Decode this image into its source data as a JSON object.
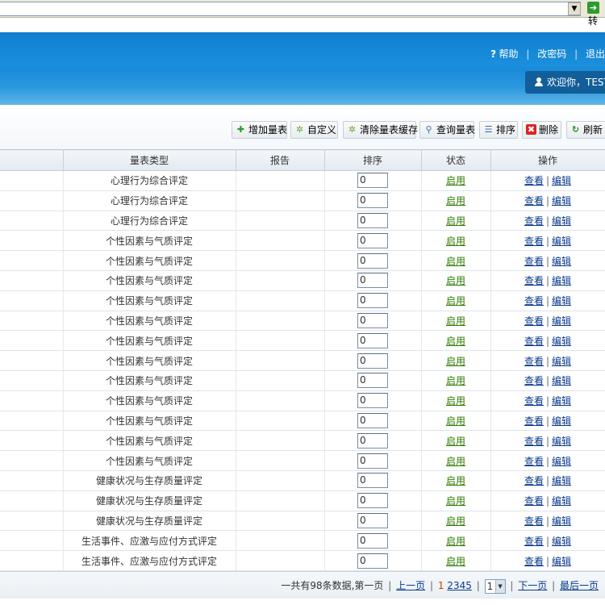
{
  "browser": {
    "go_label": "转"
  },
  "header": {
    "help": "帮助",
    "change_password": "改密码",
    "logout": "退出",
    "welcome": "欢迎你，TEST"
  },
  "toolbar": {
    "add": "增加量表",
    "custom": "自定义",
    "clear_cache": "清除量表缓存",
    "query": "查询量表",
    "sort": "排序",
    "delete": "删除",
    "refresh": "刷新"
  },
  "table": {
    "columns": [
      "",
      "量表类型",
      "报告",
      "排序",
      "状态",
      "操作"
    ],
    "status_label": "启用",
    "view_label": "查看",
    "edit_label": "编辑",
    "rows": [
      {
        "type": "心理行为综合评定",
        "order": "0"
      },
      {
        "type": "心理行为综合评定",
        "order": "0"
      },
      {
        "type": "心理行为综合评定",
        "order": "0"
      },
      {
        "type": "个性因素与气质评定",
        "order": "0"
      },
      {
        "type": "个性因素与气质评定",
        "order": "0"
      },
      {
        "type": "个性因素与气质评定",
        "order": "0"
      },
      {
        "type": "个性因素与气质评定",
        "order": "0"
      },
      {
        "type": "个性因素与气质评定",
        "order": "0"
      },
      {
        "type": "个性因素与气质评定",
        "order": "0"
      },
      {
        "type": "个性因素与气质评定",
        "order": "0"
      },
      {
        "type": "个性因素与气质评定",
        "order": "0"
      },
      {
        "type": "个性因素与气质评定",
        "order": "0"
      },
      {
        "type": "个性因素与气质评定",
        "order": "0"
      },
      {
        "type": "个性因素与气质评定",
        "order": "0"
      },
      {
        "type": "个性因素与气质评定",
        "order": "0"
      },
      {
        "type": "健康状况与生存质量评定",
        "order": "0"
      },
      {
        "type": "健康状况与生存质量评定",
        "order": "0"
      },
      {
        "type": "健康状况与生存质量评定",
        "order": "0"
      },
      {
        "type": "生活事件、应激与应付方式评定",
        "order": "0"
      },
      {
        "type": "生活事件、应激与应付方式评定",
        "order": "0"
      }
    ]
  },
  "pager": {
    "summary": "一共有98条数据,第一页",
    "prev": "上一页",
    "pages": [
      "1",
      "2",
      "3",
      "4",
      "5"
    ],
    "current": "1",
    "select_value": "1",
    "next": "下一页",
    "last": "最后一页"
  },
  "colors": {
    "header_blue": "#1585d2",
    "status_green": "#2d7a00",
    "link_blue": "#0a3a8a",
    "current_page": "#d03c00"
  }
}
